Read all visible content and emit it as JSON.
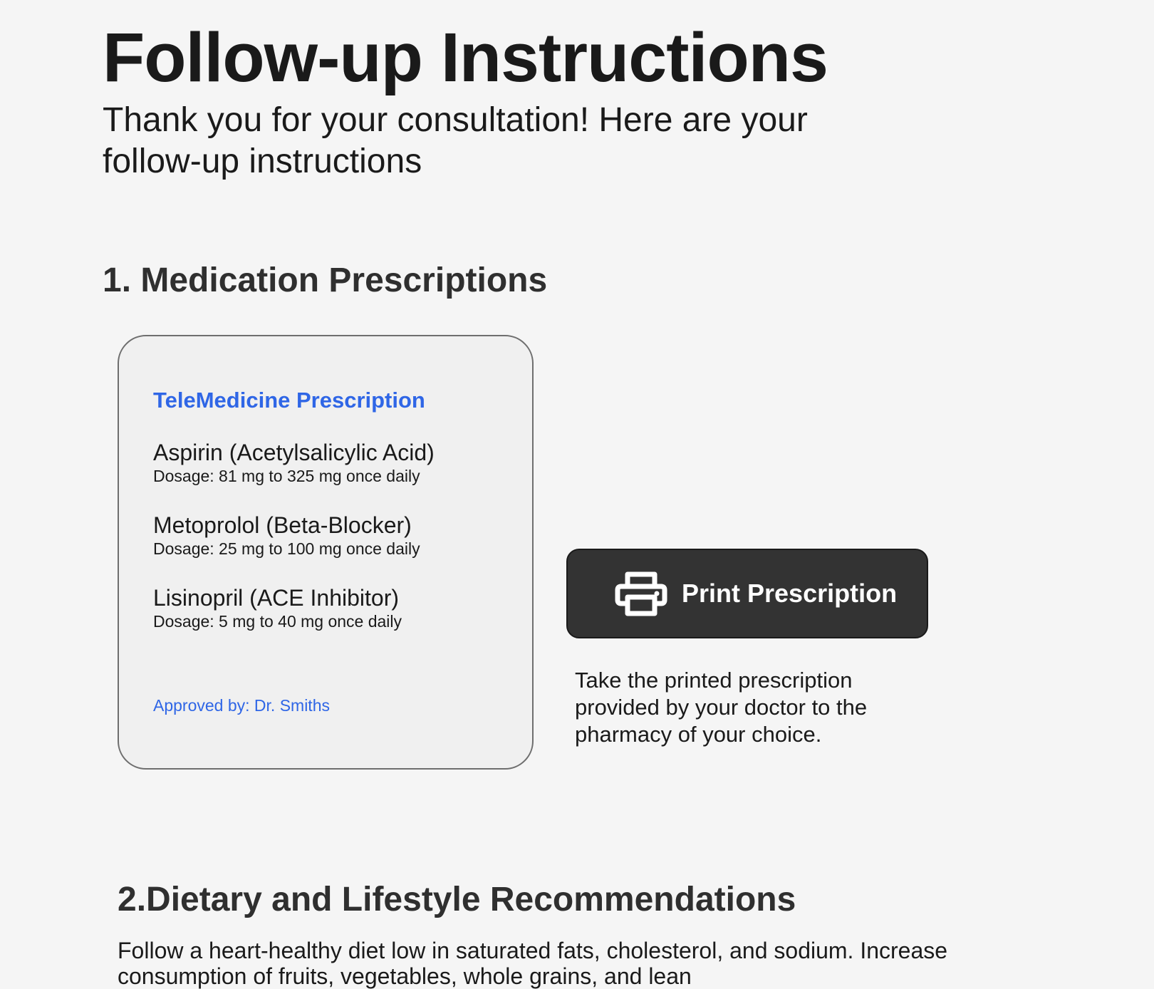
{
  "header": {
    "title": "Follow-up Instructions",
    "subtitle": "Thank you for your consultation! Here are your follow-up instructions"
  },
  "section1": {
    "heading": "1. Medication Prescriptions",
    "card": {
      "title": "TeleMedicine Prescription",
      "medications": [
        {
          "name": "Aspirin (Acetylsalicylic Acid)",
          "dosage": "Dosage: 81 mg to 325 mg once daily"
        },
        {
          "name": "Metoprolol (Beta-Blocker)",
          "dosage": "Dosage: 25 mg to 100 mg once daily"
        },
        {
          "name": "Lisinopril (ACE Inhibitor)",
          "dosage": "Dosage: 5 mg to 40 mg once daily"
        }
      ],
      "approved_by": "Approved by: Dr. Smiths"
    },
    "print_button": {
      "label": "Print Prescription",
      "icon": "printer-icon"
    },
    "print_note": "Take the printed prescription provided by your doctor to the pharmacy of your choice."
  },
  "section2": {
    "heading": "2.Dietary and Lifestyle Recommendations",
    "text": "Follow a heart-healthy diet low in saturated fats, cholesterol, and sodium. Increase consumption of fruits, vegetables, whole grains, and lean"
  },
  "colors": {
    "background": "#f5f5f5",
    "accent_blue": "#2f66e6",
    "button_dark": "#333333",
    "card_border": "#6e6e6e"
  }
}
